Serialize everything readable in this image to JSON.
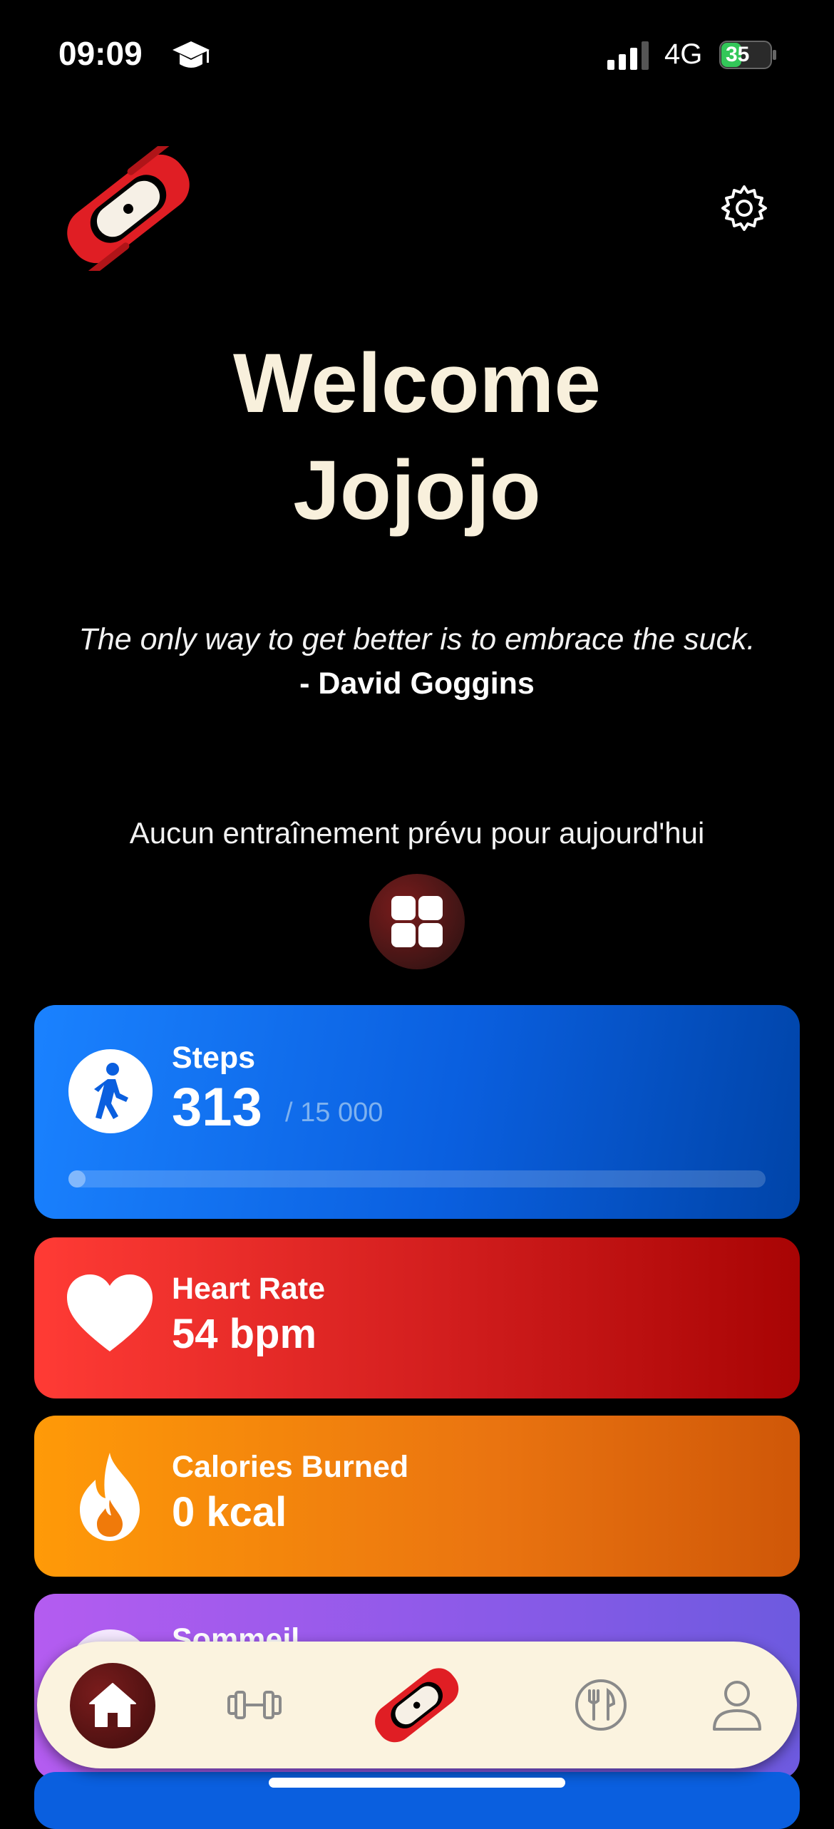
{
  "status_bar": {
    "time": "09:09",
    "network": "4G",
    "battery": "35"
  },
  "header": {
    "logo_icon": "app-logo",
    "settings_icon": "gear-icon"
  },
  "welcome": {
    "line1": "Welcome",
    "name": "Jojojo"
  },
  "quote": {
    "text": "The only way to get better is to embrace the suck.",
    "author": "- David Goggins"
  },
  "workout": {
    "status": "Aucun entraînement prévu pour aujourd'hui",
    "button_icon": "grid-icon"
  },
  "cards": {
    "steps": {
      "title": "Steps",
      "value": "313",
      "goal": "/ 15 000",
      "progress": 0.02087,
      "color": "#1a82ff"
    },
    "heart": {
      "title": "Heart Rate",
      "value": "54 bpm",
      "color": "#ff3b35"
    },
    "calories": {
      "title": "Calories Burned",
      "value": "0 kcal",
      "color": "#ff9a08"
    },
    "sleep": {
      "title": "Sommeil",
      "color": "#b45cf0"
    }
  },
  "tabbar": {
    "items": [
      {
        "icon": "home-icon",
        "active": true
      },
      {
        "icon": "dumbbell-icon",
        "active": false
      },
      {
        "icon": "app-logo",
        "active": false
      },
      {
        "icon": "fork-knife-icon",
        "active": false
      },
      {
        "icon": "profile-icon",
        "active": false
      }
    ]
  },
  "colors": {
    "welcome_text": "#f8f0dc",
    "tabbar_bg": "#fbf3df",
    "accent": "#7a1c1c"
  }
}
